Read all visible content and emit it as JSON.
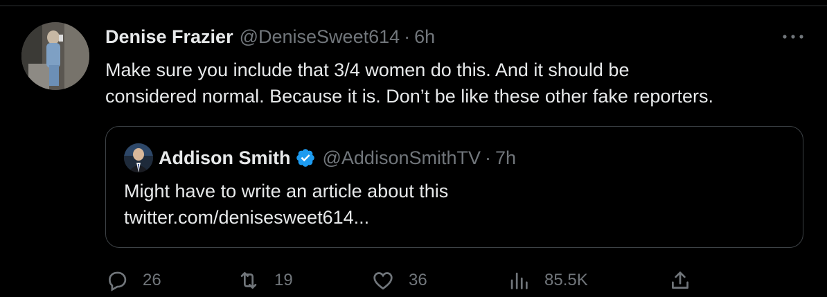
{
  "tweet": {
    "author_name": "Denise Frazier",
    "handle": "@DeniseSweet614",
    "separator": "·",
    "time": "6h",
    "text_line1": "Make sure you include that 3/4 women do this. And it should be",
    "text_line2": "considered normal. Because it is. Don’t be like these other fake reporters.",
    "more_icon": "more-horizontal-icon"
  },
  "quote": {
    "author_name": "Addison Smith",
    "handle": "@AddisonSmithTV",
    "separator": "·",
    "time": "7h",
    "text_line1": "Might have to write an article about this",
    "link": "twitter.com/denisesweet614...",
    "verified_color": "#1d9bf0"
  },
  "actions": {
    "replies": "26",
    "retweets": "19",
    "likes": "36",
    "views": "85.5K"
  },
  "colors": {
    "background": "#000000",
    "text": "#e7e9ea",
    "muted": "#71767b",
    "border": "#2f3336"
  }
}
